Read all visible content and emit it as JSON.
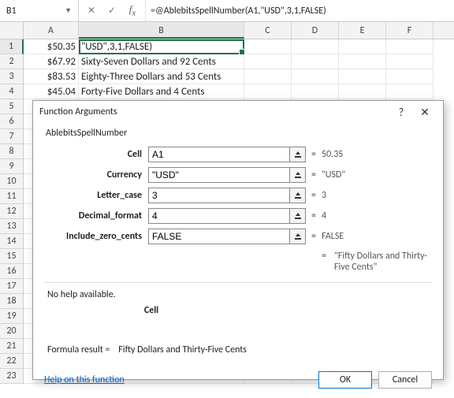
{
  "namebox": {
    "value": "B1"
  },
  "formula_bar": {
    "text": "=@AblebitsSpellNumber(A1,\"USD\",3,1,FALSE)"
  },
  "columns": [
    "A",
    "B",
    "C",
    "D",
    "E",
    "F"
  ],
  "rows": [
    {
      "n": "1",
      "a": "$50.35",
      "b": "\"USD\",3,1,FALSE)"
    },
    {
      "n": "2",
      "a": "$67.92",
      "b": "Sixty-Seven Dollars and 92 Cents"
    },
    {
      "n": "3",
      "a": "$83.53",
      "b": "Eighty-Three Dollars and 53 Cents"
    },
    {
      "n": "4",
      "a": "$45.04",
      "b": "Forty-Five Dollars and 4 Cents"
    },
    {
      "n": "5",
      "a": "",
      "b": ""
    },
    {
      "n": "6",
      "a": "",
      "b": ""
    },
    {
      "n": "7",
      "a": "",
      "b": ""
    },
    {
      "n": "8",
      "a": "",
      "b": ""
    },
    {
      "n": "9",
      "a": "",
      "b": ""
    },
    {
      "n": "10",
      "a": "",
      "b": ""
    },
    {
      "n": "11",
      "a": "",
      "b": ""
    },
    {
      "n": "12",
      "a": "",
      "b": ""
    },
    {
      "n": "13",
      "a": "",
      "b": ""
    },
    {
      "n": "14",
      "a": "",
      "b": ""
    },
    {
      "n": "15",
      "a": "",
      "b": ""
    },
    {
      "n": "16",
      "a": "",
      "b": ""
    },
    {
      "n": "17",
      "a": "",
      "b": ""
    },
    {
      "n": "18",
      "a": "",
      "b": ""
    },
    {
      "n": "19",
      "a": "",
      "b": ""
    },
    {
      "n": "20",
      "a": "",
      "b": ""
    },
    {
      "n": "21",
      "a": "",
      "b": ""
    },
    {
      "n": "22",
      "a": "",
      "b": ""
    },
    {
      "n": "23",
      "a": "",
      "b": ""
    }
  ],
  "dialog": {
    "title": "Function Arguments",
    "fn_name": "AblebitsSpellNumber",
    "args": [
      {
        "label": "Cell",
        "value": "A1",
        "resolved": "50.35"
      },
      {
        "label": "Currency",
        "value": "\"USD\"",
        "resolved": "\"USD\""
      },
      {
        "label": "Letter_case",
        "value": "3",
        "resolved": "3"
      },
      {
        "label": "Decimal_format",
        "value": "4",
        "resolved": "4"
      },
      {
        "label": "Include_zero_cents",
        "value": "FALSE",
        "resolved": "FALSE"
      }
    ],
    "result_preview": "\"Fifty Dollars and Thirty-Five Cents\"",
    "no_help": "No help available.",
    "current_arg": "Cell",
    "formula_result_label": "Formula result =",
    "formula_result_value": "Fifty Dollars and Thirty-Five Cents",
    "help_link": "Help on this function",
    "help_symbol": "?",
    "close_symbol": "✕",
    "ok": "OK",
    "cancel": "Cancel",
    "eq": "="
  }
}
